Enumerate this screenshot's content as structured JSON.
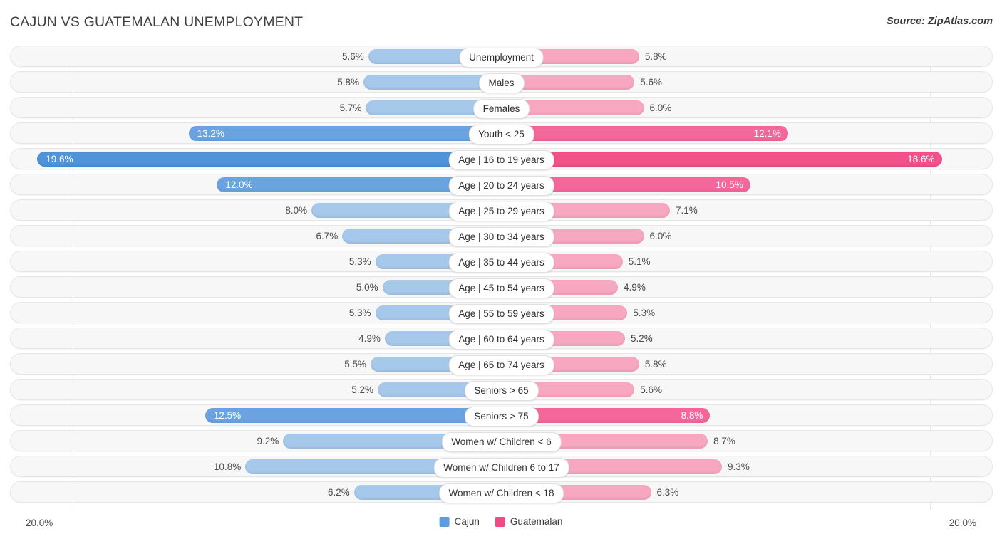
{
  "header": {
    "title": "CAJUN VS GUATEMALAN UNEMPLOYMENT",
    "source": "Source: ZipAtlas.com"
  },
  "axis": {
    "left_max_label": "20.0%",
    "right_max_label": "20.0%"
  },
  "legend": {
    "items": [
      {
        "label": "Cajun",
        "color": "#5d9ce0"
      },
      {
        "label": "Guatemalan",
        "color": "#f04b86"
      }
    ]
  },
  "chart_data": {
    "type": "bar",
    "title": "CAJUN VS GUATEMALAN UNEMPLOYMENT",
    "subtitle": "Source: ZipAtlas.com",
    "orientation": "horizontal-diverging",
    "xlabel": "",
    "ylabel": "",
    "xlim": [
      0,
      20
    ],
    "axis_max": 20.0,
    "axis_min_label": "20.0%",
    "axis_max_label": "20.0%",
    "grid": false,
    "legend_position": "bottom-center",
    "categories": [
      "Unemployment",
      "Males",
      "Females",
      "Youth < 25",
      "Age | 16 to 19 years",
      "Age | 20 to 24 years",
      "Age | 25 to 29 years",
      "Age | 30 to 34 years",
      "Age | 35 to 44 years",
      "Age | 45 to 54 years",
      "Age | 55 to 59 years",
      "Age | 60 to 64 years",
      "Age | 65 to 74 years",
      "Seniors > 65",
      "Seniors > 75",
      "Women w/ Children < 6",
      "Women w/ Children 6 to 17",
      "Women w/ Children < 18"
    ],
    "series": [
      {
        "name": "Cajun",
        "color": "#a6c8ea",
        "values": [
          5.6,
          5.8,
          5.7,
          13.2,
          19.6,
          12.0,
          8.0,
          6.7,
          5.3,
          5.0,
          5.3,
          4.9,
          5.5,
          5.2,
          12.5,
          9.2,
          10.8,
          6.2
        ],
        "labels": [
          "5.6%",
          "5.8%",
          "5.7%",
          "13.2%",
          "19.6%",
          "12.0%",
          "8.0%",
          "6.7%",
          "5.3%",
          "5.0%",
          "5.3%",
          "4.9%",
          "5.5%",
          "5.2%",
          "12.5%",
          "9.2%",
          "10.8%",
          "6.2%"
        ]
      },
      {
        "name": "Guatemalan",
        "color": "#f7a7c0",
        "values": [
          5.8,
          5.6,
          6.0,
          12.1,
          18.6,
          10.5,
          7.1,
          6.0,
          5.1,
          4.9,
          5.3,
          5.2,
          5.8,
          5.6,
          8.8,
          8.7,
          9.3,
          6.3
        ],
        "labels": [
          "5.8%",
          "5.6%",
          "6.0%",
          "12.1%",
          "18.6%",
          "10.5%",
          "7.1%",
          "6.0%",
          "5.1%",
          "4.9%",
          "5.3%",
          "5.2%",
          "5.8%",
          "5.6%",
          "8.8%",
          "8.7%",
          "9.3%",
          "6.3%"
        ]
      }
    ]
  },
  "rows": [
    {
      "label": "Unemployment",
      "left": 5.6,
      "left_label": "5.6%",
      "right": 5.8,
      "right_label": "5.8%",
      "emphasis": 0
    },
    {
      "label": "Males",
      "left": 5.8,
      "left_label": "5.8%",
      "right": 5.6,
      "right_label": "5.6%",
      "emphasis": 0
    },
    {
      "label": "Females",
      "left": 5.7,
      "left_label": "5.7%",
      "right": 6.0,
      "right_label": "6.0%",
      "emphasis": 0
    },
    {
      "label": "Youth < 25",
      "left": 13.2,
      "left_label": "13.2%",
      "right": 12.1,
      "right_label": "12.1%",
      "emphasis": 1
    },
    {
      "label": "Age | 16 to 19 years",
      "left": 19.6,
      "left_label": "19.6%",
      "right": 18.6,
      "right_label": "18.6%",
      "emphasis": 2
    },
    {
      "label": "Age | 20 to 24 years",
      "left": 12.0,
      "left_label": "12.0%",
      "right": 10.5,
      "right_label": "10.5%",
      "emphasis": 1
    },
    {
      "label": "Age | 25 to 29 years",
      "left": 8.0,
      "left_label": "8.0%",
      "right": 7.1,
      "right_label": "7.1%",
      "emphasis": 0
    },
    {
      "label": "Age | 30 to 34 years",
      "left": 6.7,
      "left_label": "6.7%",
      "right": 6.0,
      "right_label": "6.0%",
      "emphasis": 0
    },
    {
      "label": "Age | 35 to 44 years",
      "left": 5.3,
      "left_label": "5.3%",
      "right": 5.1,
      "right_label": "5.1%",
      "emphasis": 0
    },
    {
      "label": "Age | 45 to 54 years",
      "left": 5.0,
      "left_label": "5.0%",
      "right": 4.9,
      "right_label": "4.9%",
      "emphasis": 0
    },
    {
      "label": "Age | 55 to 59 years",
      "left": 5.3,
      "left_label": "5.3%",
      "right": 5.3,
      "right_label": "5.3%",
      "emphasis": 0
    },
    {
      "label": "Age | 60 to 64 years",
      "left": 4.9,
      "left_label": "4.9%",
      "right": 5.2,
      "right_label": "5.2%",
      "emphasis": 0
    },
    {
      "label": "Age | 65 to 74 years",
      "left": 5.5,
      "left_label": "5.5%",
      "right": 5.8,
      "right_label": "5.8%",
      "emphasis": 0
    },
    {
      "label": "Seniors > 65",
      "left": 5.2,
      "left_label": "5.2%",
      "right": 5.6,
      "right_label": "5.6%",
      "emphasis": 0
    },
    {
      "label": "Seniors > 75",
      "left": 12.5,
      "left_label": "12.5%",
      "right": 8.8,
      "right_label": "8.8%",
      "emphasis": 1
    },
    {
      "label": "Women w/ Children < 6",
      "left": 9.2,
      "left_label": "9.2%",
      "right": 8.7,
      "right_label": "8.7%",
      "emphasis": 0
    },
    {
      "label": "Women w/ Children 6 to 17",
      "left": 10.8,
      "left_label": "10.8%",
      "right": 9.3,
      "right_label": "9.3%",
      "emphasis": 0
    },
    {
      "label": "Women w/ Children < 18",
      "left": 6.2,
      "left_label": "6.2%",
      "right": 6.3,
      "right_label": "6.3%",
      "emphasis": 0
    }
  ]
}
